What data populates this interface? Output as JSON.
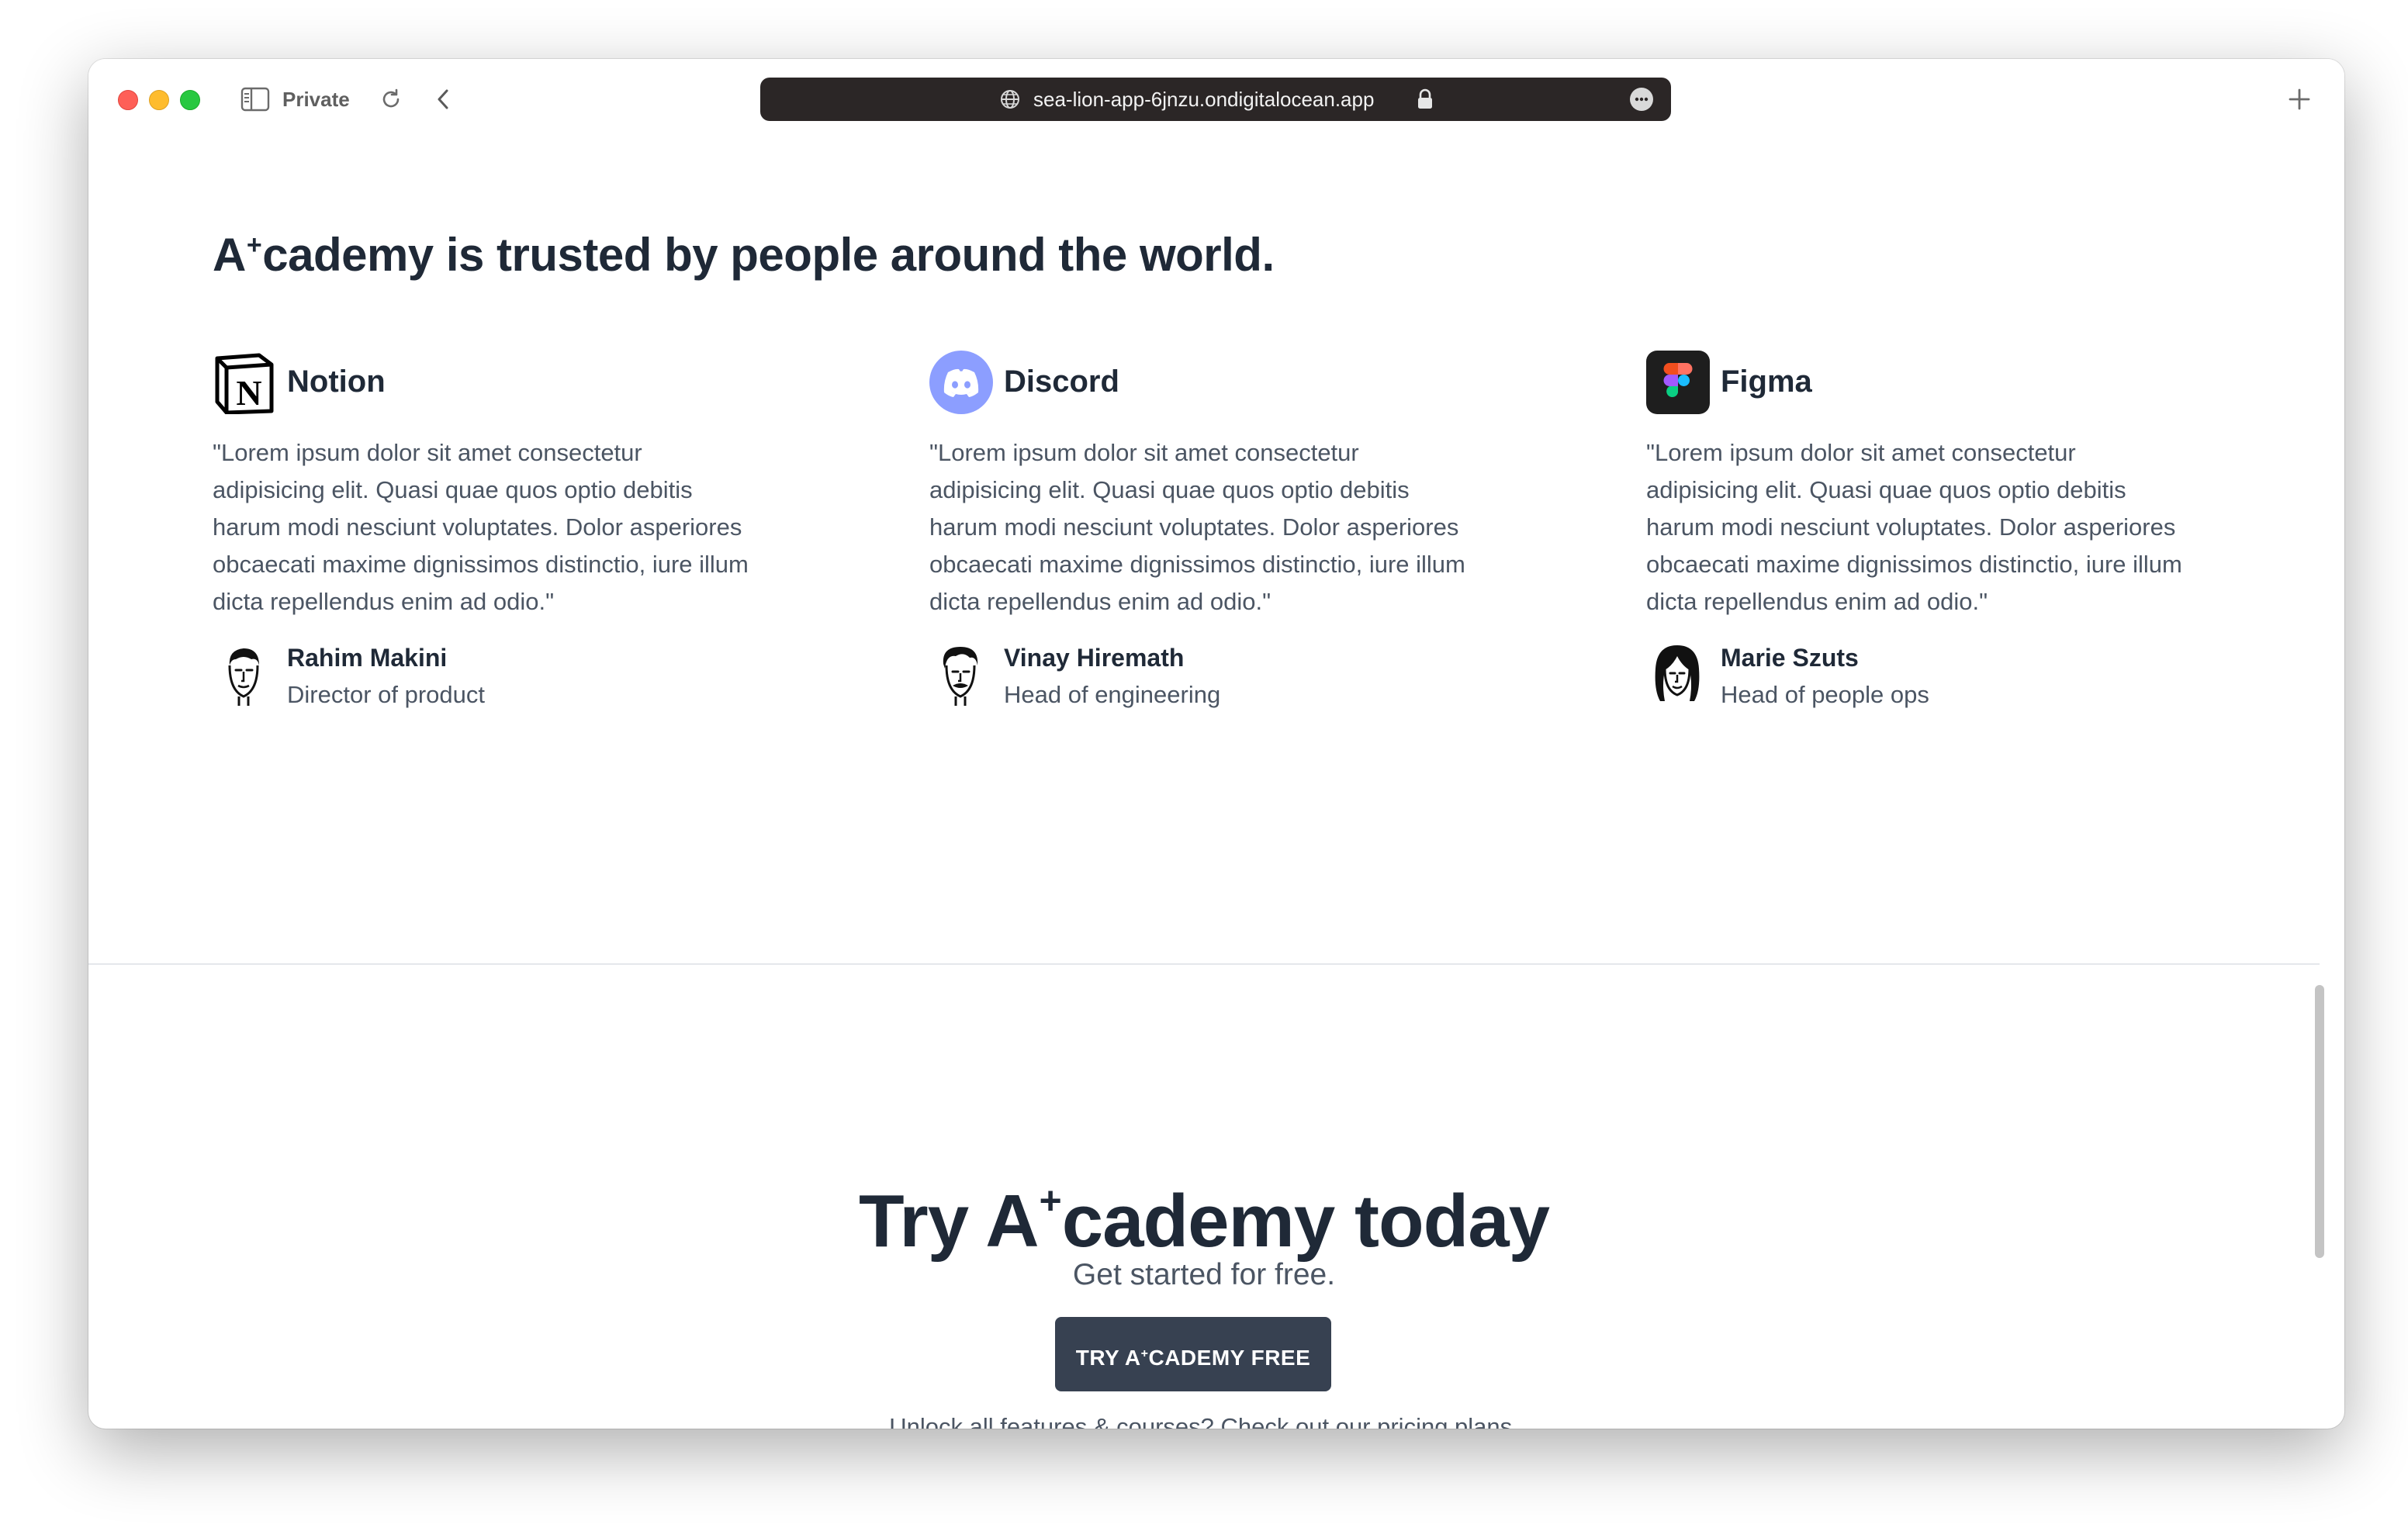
{
  "browser": {
    "private_label": "Private",
    "url": "sea-lion-app-6jnzu.ondigitalocean.app"
  },
  "testimonials": {
    "heading_prefix": "A",
    "heading_sup": "+",
    "heading_rest": "cademy is trusted by people around the world.",
    "cards": [
      {
        "company": "Notion",
        "logo": "notion-logo",
        "quote": "\"Lorem ipsum dolor sit amet consectetur adipisicing elit. Quasi quae quos optio debitis harum modi nesciunt voluptates. Dolor asperiores obcaecati maxime dignissimos distinctio, iure illum dicta repellendus enim ad odio.\"",
        "name": "Rahim Makini",
        "role": "Director of product"
      },
      {
        "company": "Discord",
        "logo": "discord-logo",
        "quote": "\"Lorem ipsum dolor sit amet consectetur adipisicing elit. Quasi quae quos optio debitis harum modi nesciunt voluptates. Dolor asperiores obcaecati maxime dignissimos distinctio, iure illum dicta repellendus enim ad odio.\"",
        "name": "Vinay Hiremath",
        "role": "Head of engineering"
      },
      {
        "company": "Figma",
        "logo": "figma-logo",
        "quote": "\"Lorem ipsum dolor sit amet consectetur adipisicing elit. Quasi quae quos optio debitis harum modi nesciunt voluptates. Dolor asperiores obcaecati maxime dignissimos distinctio, iure illum dicta repellendus enim ad odio.\"",
        "name": "Marie Szuts",
        "role": "Head of people ops"
      }
    ]
  },
  "cta": {
    "title_prefix": "Try A",
    "title_sup": "+",
    "title_rest": "cademy today",
    "subtitle": "Get started for free.",
    "button_prefix": "TRY A",
    "button_sup": "+",
    "button_rest": "CADEMY FREE",
    "note": "Unlock all features & courses? Check out our pricing plans."
  },
  "colors": {
    "heading": "#1f2937",
    "body": "#4b5563",
    "button_bg": "#374151",
    "discord": "#8c9eff",
    "addressbar_bg": "#2b2626"
  }
}
